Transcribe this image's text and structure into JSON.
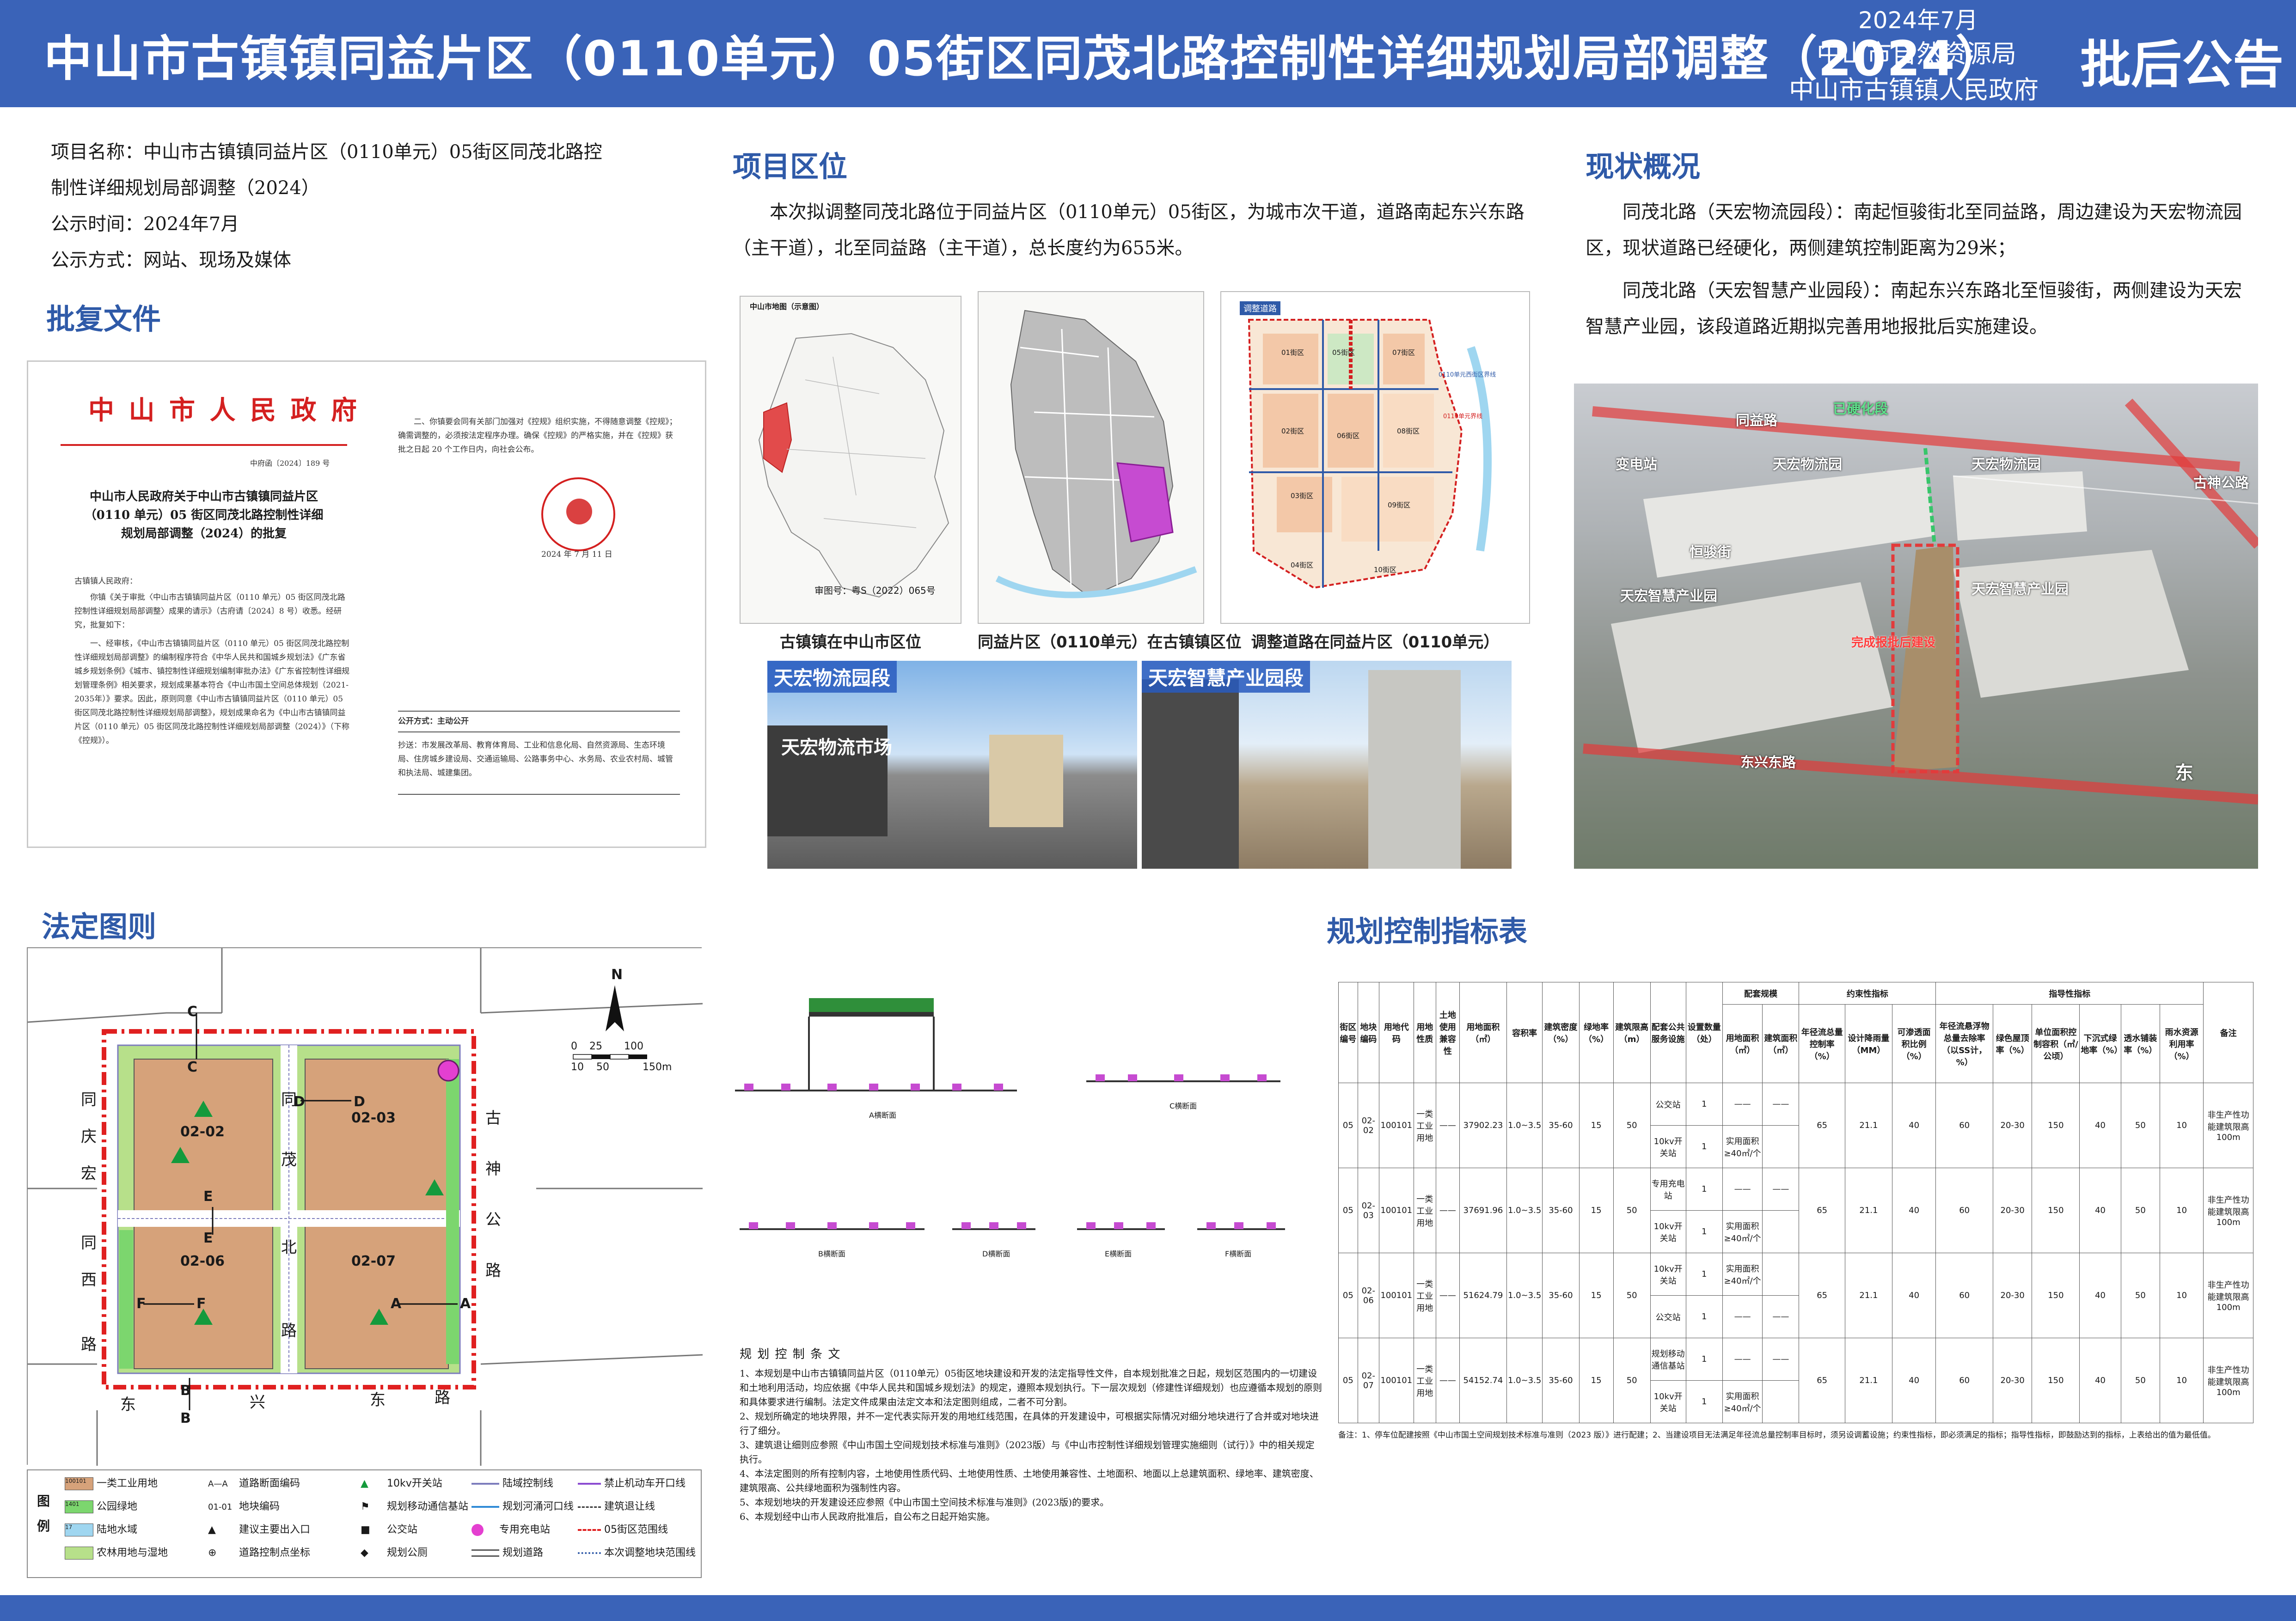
{
  "header": {
    "title": "中山市古镇镇同益片区（0110单元）05街区同茂北路控制性详细规划局部调整（2024）",
    "date": "2024年7月",
    "org1": "中山市自然资源局",
    "org2": "中山市古镇镇人民政府",
    "notice": "批后公告"
  },
  "project": {
    "name_line1": "项目名称：中山市古镇镇同益片区（0110单元）05街区同茂北路控",
    "name_line2": "制性详细规划局部调整（2024）",
    "time": "公示时间：2024年7月",
    "method": "公示方式：网站、现场及媒体"
  },
  "approval": {
    "section_title": "批复文件",
    "gov_title": "中 山 市 人 民 政 府",
    "doc_no": "中府函〔2024〕189 号",
    "doc_heading": "中山市人民政府关于中山市古镇镇同益片区（0110 单元）05 街区同茂北路控制性详细规划局部调整（2024）的批复",
    "addressee": "古镇镇人民政府：",
    "body1": "你镇《关于审批〈中山市古镇镇同益片区（0110 单元）05 街区同茂北路控制性详细规划局部调整〉成果的请示》（古府请〔2024〕8 号）收悉。经研究，批复如下：",
    "body2": "一、经审核，《中山市古镇镇同益片区（0110 单元）05 街区同茂北路控制性详细规划局部调整》的编制程序符合《中华人民共和国城乡规划法》《广东省城乡规划条例》《城市、镇控制性详细规划编制审批办法》《广东省控制性详细规划管理条例》相关要求，规划成果基本符合《中山市国土空间总体规划（2021-2035年）》要求。因此，原则同意《中山市古镇镇同益片区（0110 单元）05 街区同茂北路控制性详细规划局部调整》，规划成果命名为《中山市古镇镇同益片区（0110 单元）05 街区同茂北路控制性详细规划局部调整（2024）》（下称《控规》）。",
    "right1": "二、你镇要会同有关部门加强对《控规》组织实施，不得随意调整《控规》；确需调整的，必须按法定程序办理。确保《控规》的严格实施，并在《控规》获批之日起 20 个工作日内，向社会公布。",
    "seal_date": "2024 年 7 月 11 日",
    "public_method": "公开方式：主动公开",
    "cc": "抄送：市发展改革局、教育体育局、工业和信息化局、自然资源局、生态环境局、住房城乡建设局、交通运输局、公路事务中心、水务局、农业农村局、城管和执法局、城建集团。"
  },
  "location": {
    "section_title": "项目区位",
    "text": "本次拟调整同茂北路位于同益片区（0110单元）05街区，为城市次干道，道路南起东兴东路（主干道），北至同益路（主干道），总长度约为655米。",
    "map1_caption": "古镇镇在中山市区位",
    "map2_caption": "同益片区（0110单元）在古镇镇区位",
    "map3_caption": "调整道路在同益片区（0110单元）",
    "map1_title": "中山市地图（示意图）",
    "map1_note": "审图号：粤S（2022）065号",
    "map3_tag": "调整道路",
    "map3_labels": [
      "01街区",
      "05街区",
      "07街区",
      "02街区",
      "06街区",
      "08街区",
      "03街区",
      "09街区",
      "04街区",
      "10街区"
    ],
    "map3_road1": "0110单元西街区界线",
    "map3_road2": "0110单元界线"
  },
  "photos": {
    "photo1_label": "天宏物流园段",
    "photo2_label": "天宏智慧产业园段",
    "photo1_sign": "天宏物流市场"
  },
  "status": {
    "section_title": "现状概况",
    "para1": "同茂北路（天宏物流园段）：南起恒骏街北至同益路，周边建设为天宏物流园区，现状道路已经硬化，两侧建筑控制距离为29米；",
    "para2": "同茂北路（天宏智慧产业园段）：南起东兴东路北至恒骏街，两侧建设为天宏智慧产业园，该段道路近期拟完善用地报批后实施建设。",
    "aerial_labels": {
      "road_top": "同益路",
      "hardened": "已硬化段",
      "yard": "变电站",
      "logistics1": "天宏物流园",
      "logistics2": "天宏物流园",
      "street": "恒骏街",
      "smart1": "天宏智慧产业园",
      "smart2": "天宏智慧产业园",
      "pending": "完成报批后建设",
      "road_bottom": "东兴东路",
      "road_right": "古神公路",
      "east": "东"
    }
  },
  "statutory": {
    "section_title": "法定图则",
    "scale_labels": [
      "0",
      "25",
      "100",
      "10",
      "50",
      "150m"
    ],
    "north": "N",
    "parcels": [
      "02-02",
      "02-03",
      "02-06",
      "02-07"
    ],
    "section_marks": [
      "C",
      "C",
      "D",
      "D",
      "E",
      "E",
      "F",
      "F",
      "A",
      "A",
      "B",
      "B"
    ],
    "road_chars_left": [
      "同",
      "庆",
      "宏",
      "同",
      "西",
      "路"
    ],
    "road_chars_mid": [
      "同",
      "茂",
      "北",
      "路"
    ],
    "road_chars_right": [
      "古",
      "神",
      "公",
      "路"
    ],
    "road_chars_bottom": [
      "东",
      "兴",
      "东",
      "路"
    ],
    "legend_title": "图例",
    "legend": [
      {
        "code": "100101",
        "label": "一类工业用地",
        "color": "#d6a27a"
      },
      {
        "code": "1401",
        "label": "公园绿地",
        "color": "#7cd66e"
      },
      {
        "code": "17",
        "label": "陆地水域",
        "color": "#9fd6f0"
      },
      {
        "code": "",
        "label": "农林用地与湿地",
        "color": "#b7e08a"
      },
      {
        "code": "A—A",
        "label": "道路断面编码",
        "color": ""
      },
      {
        "code": "01-01",
        "label": "地块编码",
        "color": ""
      },
      {
        "code": "",
        "label": "建议主要出入口",
        "color": ""
      },
      {
        "code": "",
        "label": "道路控制点坐标",
        "color": ""
      },
      {
        "code": "",
        "label": "10kv开关站",
        "color": ""
      },
      {
        "code": "",
        "label": "规划移动通信基站",
        "color": ""
      },
      {
        "code": "",
        "label": "公交站",
        "color": ""
      },
      {
        "code": "",
        "label": "规划公厕",
        "color": ""
      },
      {
        "code": "",
        "label": "陆域控制线",
        "color": ""
      },
      {
        "code": "",
        "label": "规划河涌河口线",
        "color": ""
      },
      {
        "code": "",
        "label": "专用充电站",
        "color": ""
      },
      {
        "code": "",
        "label": "规划道路",
        "color": ""
      },
      {
        "code": "",
        "label": "禁止机动车开口线",
        "color": ""
      },
      {
        "code": "",
        "label": "建筑退让线",
        "color": ""
      },
      {
        "code": "",
        "label": "05街区范围线",
        "color": ""
      },
      {
        "code": "",
        "label": "本次调整地块范围线",
        "color": ""
      }
    ]
  },
  "sections": {
    "a_label": "A横断面",
    "c_label": "C横断面",
    "b_label": "B横断面",
    "d_label": "D横断面",
    "e_label": "E横断面",
    "f_label": "F横断面"
  },
  "clauses": {
    "title": "规 划 控 制 条 文",
    "items": [
      "1、本规划是中山市古镇镇同益片区（0110单元）05街区地块建设和开发的法定指导性文件，自本规划批准之日起，规划区范围内的一切建设和土地利用活动，均应依据《中华人民共和国城乡规划法》的规定，遵照本规划执行。下一层次规划（修建性详细规划）也应遵循本规划的原则和具体要求进行编制。法定文件成果由法定文本和法定图则组成，二者不可分割。",
      "2、规划所确定的地块界限，并不一定代表实际开发的用地红线范围，在具体的开发建设中，可根据实际情况对细分地块进行了合并或对地块进行了细分。",
      "3、建筑退让细则应参照《中山市国土空间规划技术标准与准则》（2023版）与《中山市控制性详细规划管理实施细则（试行）》中的相关规定执行。",
      "4、本法定图则的所有控制内容，土地使用性质代码、土地使用性质、土地使用兼容性、土地面积、地面以上总建筑面积、绿地率、建筑密度、建筑限高、公共绿地面积为强制性内容。",
      "5、本规划地块的开发建设还应参照《中山市国土空间技术标准与准则》(2023版)的要求。",
      "6、本规划经中山市人民政府批准后，自公布之日起开始实施。"
    ]
  },
  "indicators": {
    "section_title": "规划控制指标表",
    "head_groups": {
      "facility": "配套规模",
      "binding": "约束性指标",
      "guiding": "指导性指标"
    },
    "columns": [
      "街区编号",
      "地块编码",
      "用地代码",
      "用地性质",
      "土地使用兼容性",
      "用地面积（㎡）",
      "容积率",
      "建筑密度（%）",
      "绿地率（%）",
      "建筑限高（m）",
      "配套公共服务设施",
      "设置数量（处）",
      "用地面积（㎡）",
      "建筑面积（㎡）",
      "年径流总量控制率（%）",
      "设计降雨量（MM）",
      "可渗透面积比例（%）",
      "年径流悬浮物总量去除率（以SS计，%）",
      "绿色屋顶率（%）",
      "单位面积控制容积（㎡/公顷）",
      "下沉式绿地率（%）",
      "透水铺装率（%）",
      "雨水资源利用率（%）",
      "备注"
    ],
    "rows": [
      {
        "block": "05",
        "code": "02-02",
        "land": "100101",
        "type": "一类工业用地",
        "compat": "——",
        "area": "37902.23",
        "far": "1.0~3.5",
        "density": "35-60",
        "green": "15",
        "height": "50",
        "facilities": [
          {
            "name": "公交站",
            "num": "1",
            "area": "——",
            "barea": "——"
          },
          {
            "name": "10kv开关站",
            "num": "1",
            "area": "实用面积≥40㎡/个",
            "barea": ""
          }
        ],
        "runoff": "65",
        "rain": "21.1",
        "perm": "40",
        "ss": "60",
        "roof": "20-30",
        "vol": "150",
        "sunken": "40",
        "paving": "50",
        "reuse": "10",
        "note": "非生产性功能建筑限高100m"
      },
      {
        "block": "05",
        "code": "02-03",
        "land": "100101",
        "type": "一类工业用地",
        "compat": "——",
        "area": "37691.96",
        "far": "1.0~3.5",
        "density": "35-60",
        "green": "15",
        "height": "50",
        "facilities": [
          {
            "name": "专用充电站",
            "num": "1",
            "area": "——",
            "barea": "——"
          },
          {
            "name": "10kv开关站",
            "num": "1",
            "area": "实用面积≥40㎡/个",
            "barea": ""
          }
        ],
        "runoff": "65",
        "rain": "21.1",
        "perm": "40",
        "ss": "60",
        "roof": "20-30",
        "vol": "150",
        "sunken": "40",
        "paving": "50",
        "reuse": "10",
        "note": "非生产性功能建筑限高100m"
      },
      {
        "block": "05",
        "code": "02-06",
        "land": "100101",
        "type": "一类工业用地",
        "compat": "——",
        "area": "51624.79",
        "far": "1.0~3.5",
        "density": "35-60",
        "green": "15",
        "height": "50",
        "facilities": [
          {
            "name": "10kv开关站",
            "num": "1",
            "area": "实用面积≥40㎡/个",
            "barea": ""
          },
          {
            "name": "公交站",
            "num": "1",
            "area": "——",
            "barea": "——"
          }
        ],
        "runoff": "65",
        "rain": "21.1",
        "perm": "40",
        "ss": "60",
        "roof": "20-30",
        "vol": "150",
        "sunken": "40",
        "paving": "50",
        "reuse": "10",
        "note": "非生产性功能建筑限高100m"
      },
      {
        "block": "05",
        "code": "02-07",
        "land": "100101",
        "type": "一类工业用地",
        "compat": "——",
        "area": "54152.74",
        "far": "1.0~3.5",
        "density": "35-60",
        "green": "15",
        "height": "50",
        "facilities": [
          {
            "name": "规划移动通信基站",
            "num": "1",
            "area": "——",
            "barea": "——"
          },
          {
            "name": "10kv开关站",
            "num": "1",
            "area": "实用面积≥40㎡/个",
            "barea": ""
          }
        ],
        "runoff": "65",
        "rain": "21.1",
        "perm": "40",
        "ss": "60",
        "roof": "20-30",
        "vol": "150",
        "sunken": "40",
        "paving": "50",
        "reuse": "10",
        "note": "非生产性功能建筑限高100m"
      }
    ],
    "footnote": "备注：1、停车位配建按照《中山市国土空间规划技术标准与准则（2023 版）》进行配建；2、当建设项目无法满足年径流总量控制率目标时，须另设调蓄设施；约束性指标，即必须满足的指标；指导性指标，即鼓励达到的指标，上表给出的值为最低值。"
  }
}
